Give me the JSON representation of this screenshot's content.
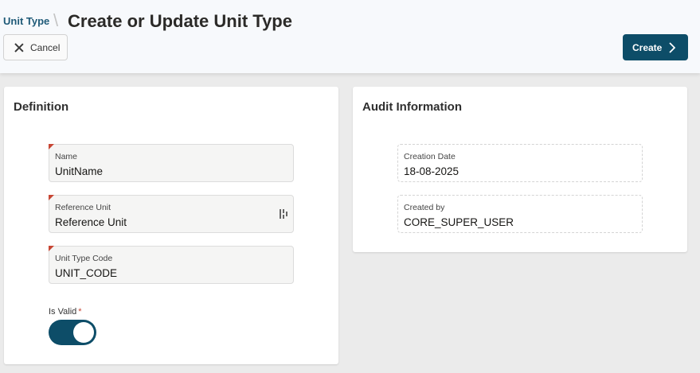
{
  "header": {
    "breadcrumb": "Unit Type",
    "separator": "\\",
    "title": "Create or Update Unit Type",
    "cancel_label": "Cancel",
    "create_label": "Create"
  },
  "definition": {
    "title": "Definition",
    "fields": [
      {
        "label": "Name",
        "value": "UnitName"
      },
      {
        "label": "Reference Unit",
        "value": "Reference Unit"
      },
      {
        "label": "Unit Type Code",
        "value": "UNIT_CODE"
      }
    ],
    "is_valid": {
      "label": "Is Valid",
      "required_mark": "*",
      "on": true
    }
  },
  "audit": {
    "title": "Audit Information",
    "fields": [
      {
        "label": "Creation Date",
        "value": "18-08-2025"
      },
      {
        "label": "Created by",
        "value": "CORE_SUPER_USER"
      }
    ]
  },
  "colors": {
    "primary": "#0d4d68",
    "breadcrumb": "#1f5a78",
    "required": "#c74634",
    "background": "#ebebeb"
  }
}
